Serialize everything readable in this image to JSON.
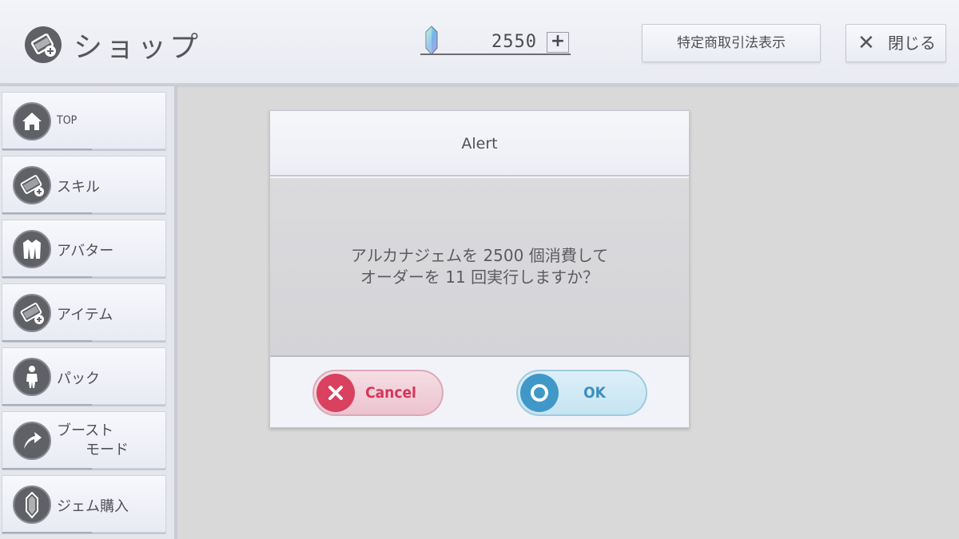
{
  "header": {
    "title": "ショップ",
    "gem_count": "2550",
    "add_label": "+",
    "legal_label": "特定商取引法表示",
    "close_label": "閉じる"
  },
  "sidebar": {
    "items": [
      {
        "label": "TOP",
        "icon": "home-icon"
      },
      {
        "label": "スキル",
        "icon": "skill-card-icon"
      },
      {
        "label": "アバター",
        "icon": "avatar-coat-icon"
      },
      {
        "label": "アイテム",
        "icon": "item-card-icon"
      },
      {
        "label": "パック",
        "icon": "person-icon"
      },
      {
        "label_line1": "ブースト",
        "label_line2": "モード",
        "icon": "boost-arrow-icon"
      },
      {
        "label": "ジェム購入",
        "icon": "gem-crystal-icon"
      }
    ]
  },
  "dialog": {
    "title": "Alert",
    "message_line1": "アルカナジェムを 2500 個消費して",
    "message_line2": "オーダーを 11 回実行しますか？",
    "cancel_label": "Cancel",
    "ok_label": "OK"
  },
  "colors": {
    "cancel_accent": "#d9415f",
    "ok_accent": "#3f98c8",
    "icon_dark": "#606167"
  }
}
